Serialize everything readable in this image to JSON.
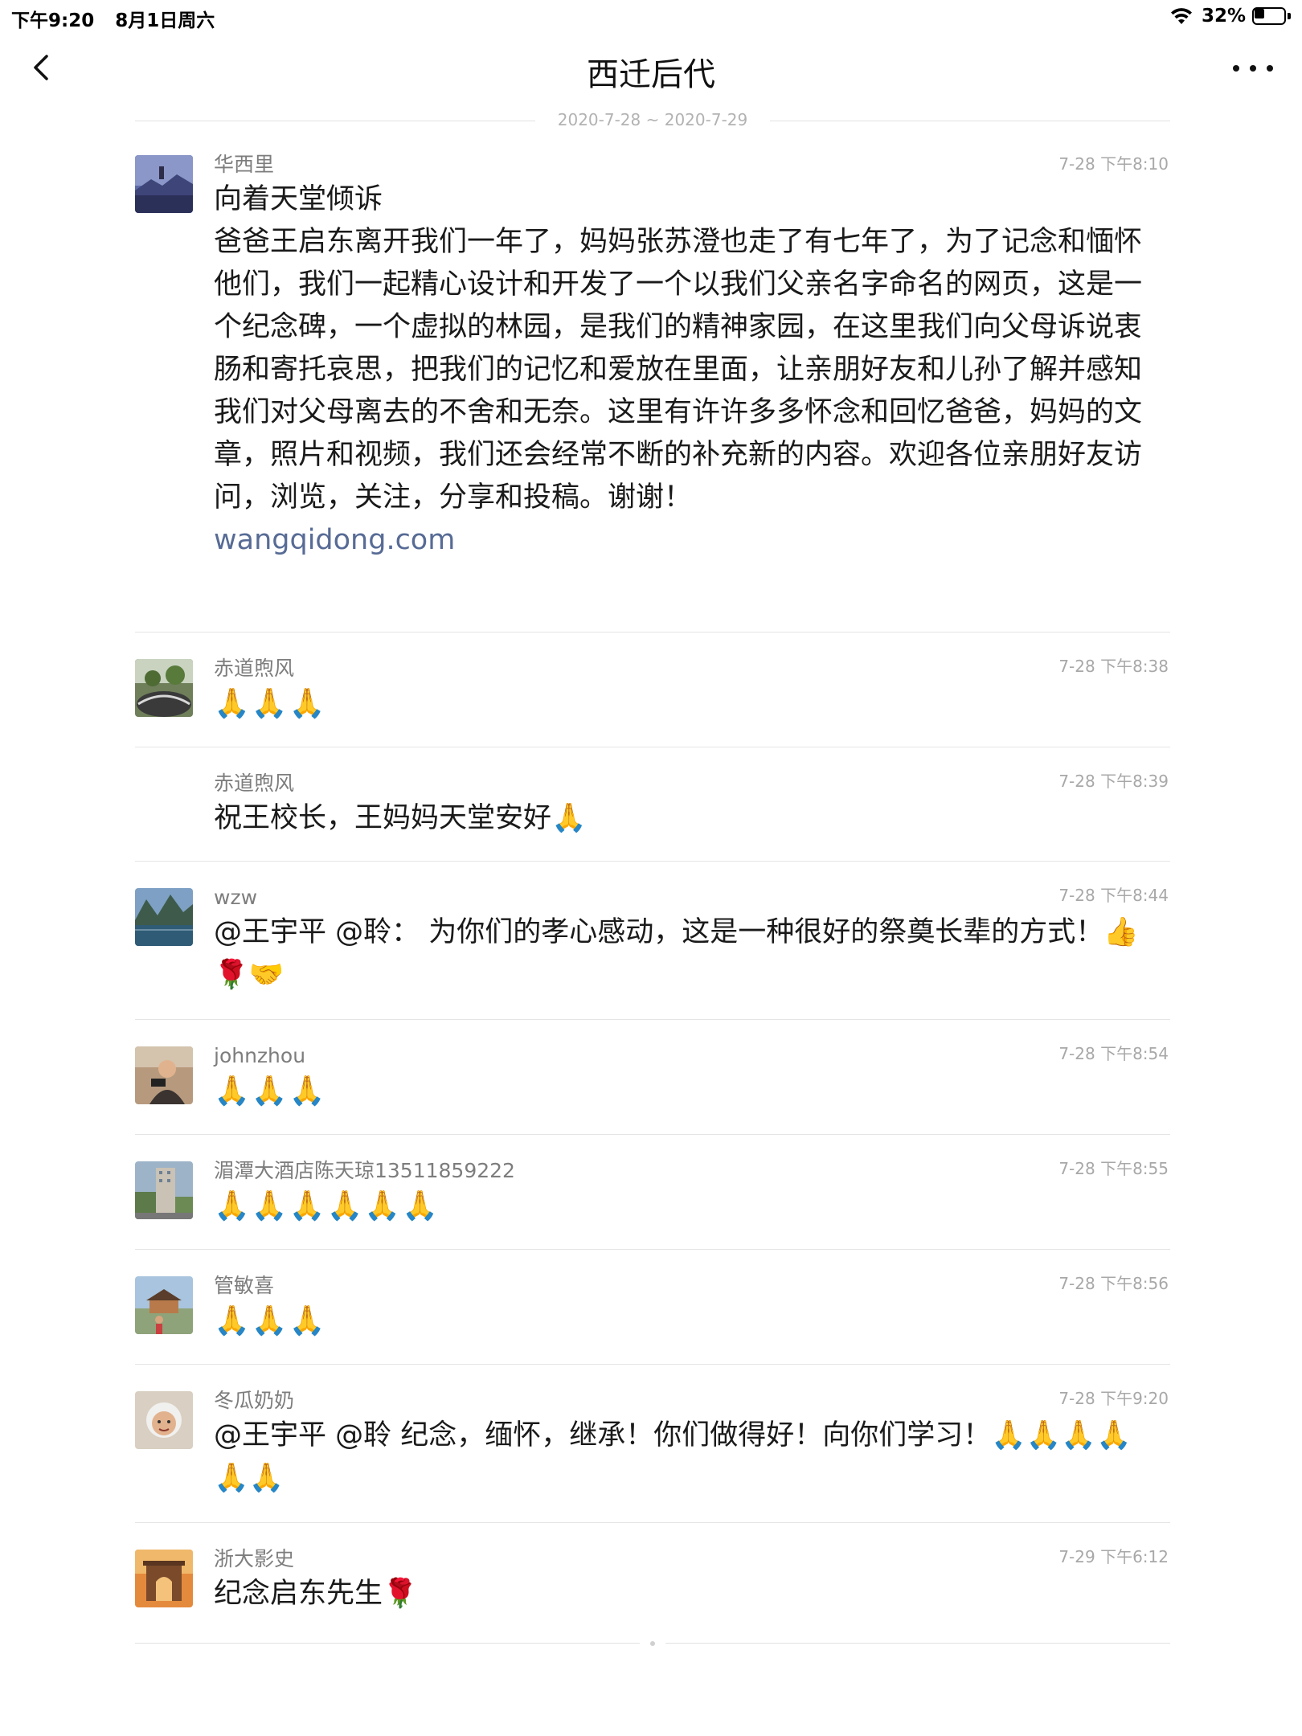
{
  "status_bar": {
    "time": "下午9:20",
    "date": "8月1日周六",
    "battery": "32%",
    "battery_level": 0.32
  },
  "header": {
    "title": "西迁后代"
  },
  "date_range": "2020-7-28 ~ 2020-7-29",
  "messages": [
    {
      "sender": "华西里",
      "time": "7-28 下午8:10",
      "text": "向着天堂倾诉\n爸爸王启东离开我们一年了，妈妈张苏澄也走了有七年了，为了记念和愐怀他们，我们一起精心设计和开发了一个以我们父亲名字命名的网页，这是一个纪念碑，一个虚拟的林园，是我们的精神家园，在这里我们向父母诉说衷肠和寄托哀思，把我们的记忆和爱放在里面，让亲朋好友和儿孙了解并感知我们对父母离去的不舍和无奈。这里有许许多多怀念和回忆爸爸，妈妈的文章，照片和视频，我们还会经常不断的补充新的内容。欢迎各位亲朋好友访问，浏览，关注，分享和投稿。谢谢！",
      "link": "wangqidong.com"
    },
    {
      "sender": "赤道煦风",
      "time": "7-28 下午8:38",
      "text": "🙏🙏🙏"
    },
    {
      "sender": "赤道煦风",
      "time": "7-28 下午8:39",
      "text": "祝王校长，王妈妈天堂安好🙏"
    },
    {
      "sender": "wzw",
      "time": "7-28 下午8:44",
      "text": "@王宇平 @聆： 为你们的孝心感动，这是一种很好的祭奠长辈的方式！👍🌹🤝"
    },
    {
      "sender": "johnzhou",
      "time": "7-28 下午8:54",
      "text": "🙏🙏🙏"
    },
    {
      "sender": "湄潭大酒店陈天琼13511859222",
      "time": "7-28 下午8:55",
      "text": "🙏🙏🙏🙏🙏🙏"
    },
    {
      "sender": "管敏喜",
      "time": "7-28 下午8:56",
      "text": "🙏🙏🙏"
    },
    {
      "sender": "冬瓜奶奶",
      "time": "7-28 下午9:20",
      "text": "@王宇平 @聆 纪念，缅怀，继承！你们做得好！向你们学习！🙏🙏🙏🙏🙏🙏"
    },
    {
      "sender": "浙大影史",
      "time": "7-29 下午6:12",
      "text": "纪念启东先生🌹"
    }
  ]
}
